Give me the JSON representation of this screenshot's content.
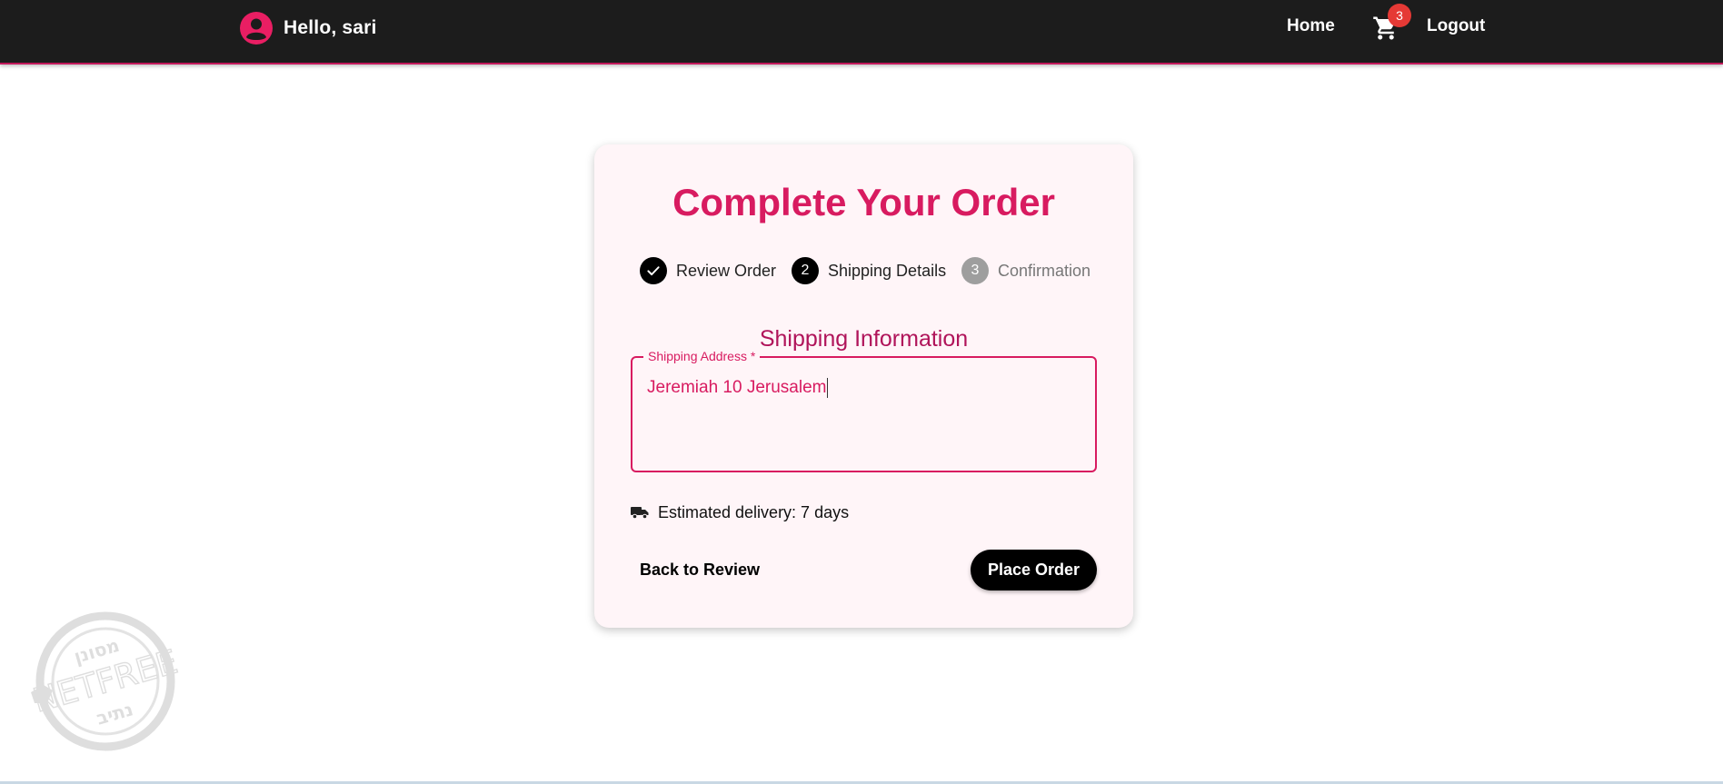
{
  "header": {
    "greeting": "Hello, sari",
    "nav_home": "Home",
    "cart_count": "3",
    "nav_logout": "Logout",
    "icons": {
      "avatar": "account-circle-icon",
      "cart": "shopping-cart-icon"
    }
  },
  "card": {
    "title": "Complete Your Order",
    "steps": [
      {
        "label": "Review Order",
        "marker": "",
        "state": "completed"
      },
      {
        "label": "Shipping Details",
        "marker": "2",
        "state": "active"
      },
      {
        "label": "Confirmation",
        "marker": "3",
        "state": "pending"
      }
    ],
    "section_title": "Shipping Information",
    "address_label": "Shipping Address *",
    "address_value": "Jeremiah 10 Jerusalem",
    "delivery_text": "Estimated delivery: 7 days",
    "back_label": "Back to Review",
    "place_label": "Place Order"
  },
  "watermark": {
    "text_top": "מסונן",
    "text_middle": "NETFREE",
    "text_bottom": "נתיב"
  },
  "colors": {
    "topbar": "#1c1c1c",
    "accent": "#d81b60",
    "card_bg": "#fff5f8",
    "badge": "#e53935",
    "button": "#000000"
  }
}
